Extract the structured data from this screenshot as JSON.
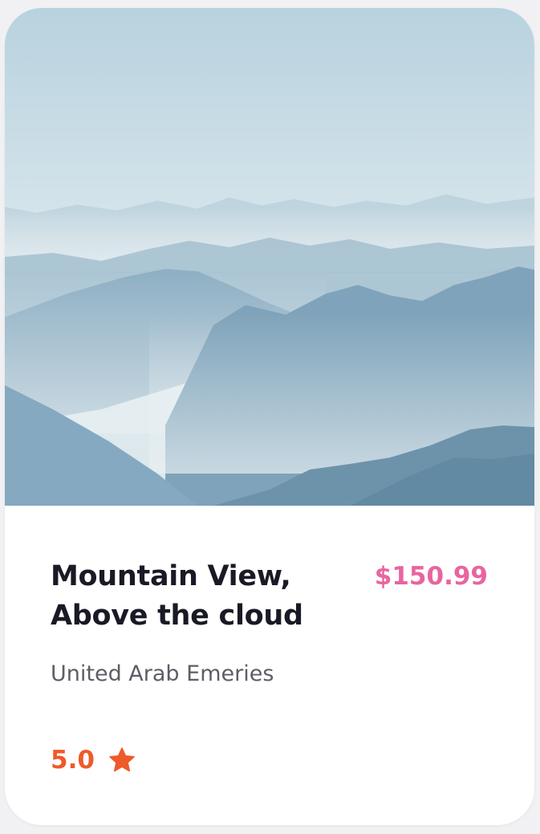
{
  "listing": {
    "image_icon": "mountain-landscape-photo",
    "title_line1": "Mountain View,",
    "title_line2": "Above the cloud",
    "price": "$150.99",
    "location": "United Arab Emeries",
    "rating": "5.0",
    "rating_icon": "star-icon"
  },
  "colors": {
    "price": "#e8659f",
    "rating": "#ee5a2a",
    "title": "#1a1a26",
    "location": "#5d5d66"
  }
}
